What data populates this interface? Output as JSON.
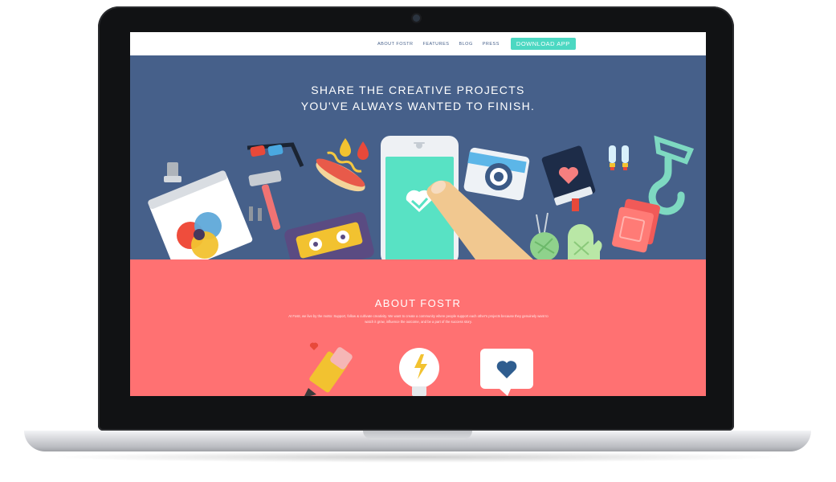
{
  "nav": {
    "links": [
      "ABOUT FOSTR",
      "FEATURES",
      "BLOG",
      "PRESS"
    ],
    "download_label": "DOWNLOAD APP"
  },
  "hero": {
    "title_line1": "SHARE THE CREATIVE PROJECTS",
    "title_line2": "YOU'VE ALWAYS WANTED TO FINISH."
  },
  "about": {
    "title": "ABOUT FOSTR",
    "body": "At Fostr, we live by the motto: Support, follow & cultivate creativity. We want to create a community where people support each other's projects because they genuinely want to watch it grow, influence the outcome, and be a part of the success story."
  },
  "colors": {
    "hero_bg": "#46608a",
    "about_bg": "#ff7172",
    "accent": "#4cd8c2",
    "frame": "#111214"
  }
}
